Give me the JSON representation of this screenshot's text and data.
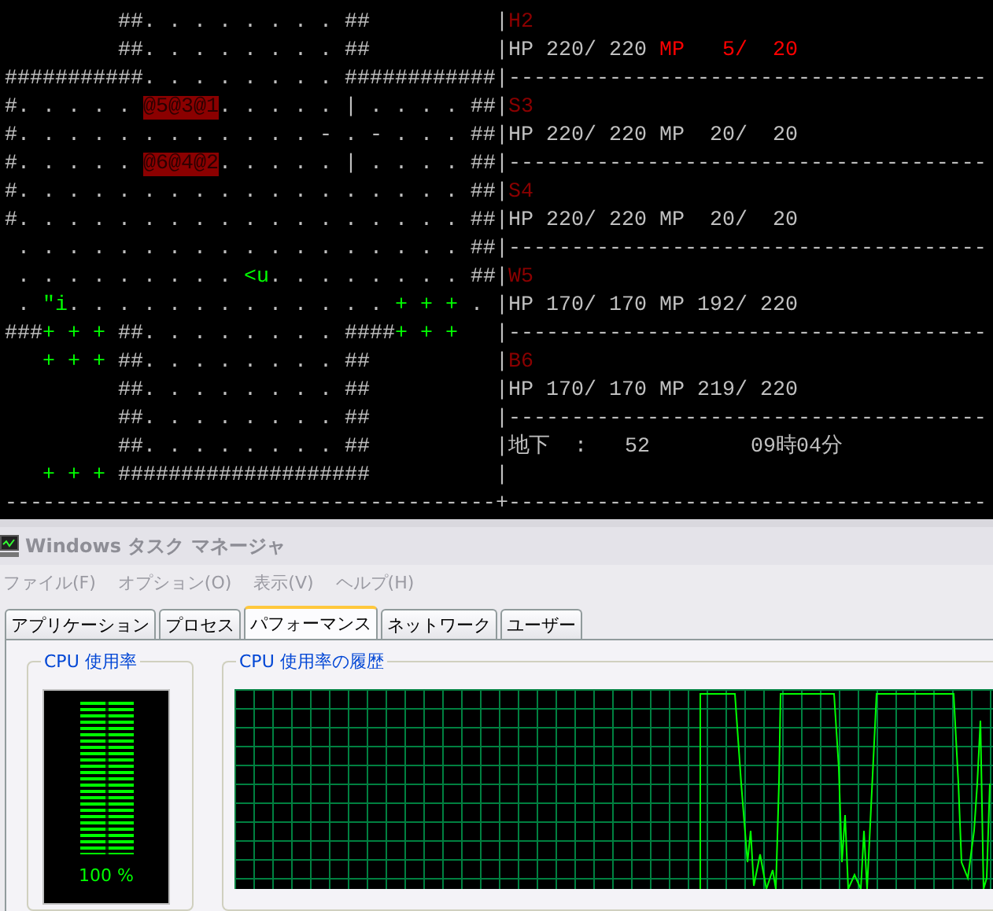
{
  "terminal": {
    "map_rows": [
      [
        {
          "kind": "text",
          "text": "         ##. . . . . . . . ##"
        }
      ],
      [
        {
          "kind": "text",
          "text": "         ##. . . . . . . . ##"
        }
      ],
      [
        {
          "kind": "text",
          "text": "###########. . . . . . . . ############"
        }
      ],
      [
        {
          "kind": "text",
          "text": "#. . . . . "
        },
        {
          "kind": "party",
          "text": "@5@3@1"
        },
        {
          "kind": "text",
          "text": ". . . . . | . . . . ##"
        }
      ],
      [
        {
          "kind": "text",
          "text": "#. . . . . . . . . . . . - . - . . . ##"
        }
      ],
      [
        {
          "kind": "text",
          "text": "#. . . . . "
        },
        {
          "kind": "party",
          "text": "@6@4@2"
        },
        {
          "kind": "text",
          "text": ". . . . . | . . . . ##"
        }
      ],
      [
        {
          "kind": "text",
          "text": "#. . . . . . . . . . . . . . . . . . ##"
        }
      ],
      [
        {
          "kind": "text",
          "text": "#. . . . . . . . . . . . . . . . . . ##"
        }
      ],
      [
        {
          "kind": "text",
          "text": " . . . . . . . . . . . . . . . . . . ##"
        }
      ],
      [
        {
          "kind": "text",
          "text": " . . . . . . . . . "
        },
        {
          "kind": "monster",
          "text": "<u"
        },
        {
          "kind": "text",
          "text": ". . . . . . . . ##"
        }
      ],
      [
        {
          "kind": "text",
          "text": " . "
        },
        {
          "kind": "item",
          "text": "\"i"
        },
        {
          "kind": "text",
          "text": ". . . . . . . . . . . . . "
        },
        {
          "kind": "plant",
          "text": "+ + +"
        },
        {
          "kind": "text",
          "text": " ."
        }
      ],
      [
        {
          "kind": "text",
          "text": "###"
        },
        {
          "kind": "plant",
          "text": "+ + +"
        },
        {
          "kind": "text",
          "text": " ##. . . . . . . . ####"
        },
        {
          "kind": "plant",
          "text": "+ + +"
        }
      ],
      [
        {
          "kind": "plant",
          "text": "   + + +"
        },
        {
          "kind": "text",
          "text": " ##. . . . . . . . ##"
        }
      ],
      [
        {
          "kind": "text",
          "text": "         ##. . . . . . . . ##"
        }
      ],
      [
        {
          "kind": "text",
          "text": "         ##. . . . . . . . ##"
        }
      ],
      [
        {
          "kind": "text",
          "text": "         ##. . . . . . . . ##"
        }
      ],
      [
        {
          "kind": "plant",
          "text": "   + + +"
        },
        {
          "kind": "text",
          "text": " ####################"
        }
      ],
      [
        {
          "kind": "text",
          "text": "---------------------------------------"
        }
      ]
    ],
    "status_rows": [
      [
        {
          "kind": "text",
          "text": "|"
        },
        {
          "kind": "name",
          "text": "H2"
        }
      ],
      [
        {
          "kind": "text",
          "text": "|HP 220/ 220 "
        },
        {
          "kind": "alert",
          "text": "MP   5/  20"
        }
      ],
      [
        {
          "kind": "text",
          "text": "|--------------------------------------"
        }
      ],
      [
        {
          "kind": "text",
          "text": "|"
        },
        {
          "kind": "name",
          "text": "S3"
        }
      ],
      [
        {
          "kind": "text",
          "text": "|HP 220/ 220 MP  20/  20"
        }
      ],
      [
        {
          "kind": "text",
          "text": "|--------------------------------------"
        }
      ],
      [
        {
          "kind": "text",
          "text": "|"
        },
        {
          "kind": "name",
          "text": "S4"
        }
      ],
      [
        {
          "kind": "text",
          "text": "|HP 220/ 220 MP  20/  20"
        }
      ],
      [
        {
          "kind": "text",
          "text": "|--------------------------------------"
        }
      ],
      [
        {
          "kind": "text",
          "text": "|"
        },
        {
          "kind": "name",
          "text": "W5"
        }
      ],
      [
        {
          "kind": "text",
          "text": "|HP 170/ 170 MP 192/ 220"
        }
      ],
      [
        {
          "kind": "text",
          "text": "|--------------------------------------"
        }
      ],
      [
        {
          "kind": "text",
          "text": "|"
        },
        {
          "kind": "name",
          "text": "B6"
        }
      ],
      [
        {
          "kind": "text",
          "text": "|HP 170/ 170 MP 219/ 220"
        }
      ],
      [
        {
          "kind": "text",
          "text": "|--------------------------------------"
        }
      ],
      [
        {
          "kind": "text",
          "text": "|地下  :   52        09時04分"
        }
      ],
      [
        {
          "kind": "text",
          "text": "|"
        }
      ],
      [
        {
          "kind": "text",
          "text": "+--------------------------------------"
        }
      ]
    ]
  },
  "window": {
    "title": "Windows タスク マネージャ",
    "menu": [
      "ファイル(F)",
      "オプション(O)",
      "表示(V)",
      "ヘルプ(H)"
    ],
    "tabs": [
      {
        "label": "アプリケーション",
        "selected": false
      },
      {
        "label": "プロセス",
        "selected": false
      },
      {
        "label": "パフォーマンス",
        "selected": true
      },
      {
        "label": "ネットワーク",
        "selected": false
      },
      {
        "label": "ユーザー",
        "selected": false
      }
    ],
    "cpu_usage": {
      "title": "CPU 使用率",
      "level": 1,
      "reading": "100 %"
    },
    "cpu_history": {
      "title": "CPU 使用率の履歴"
    }
  }
}
